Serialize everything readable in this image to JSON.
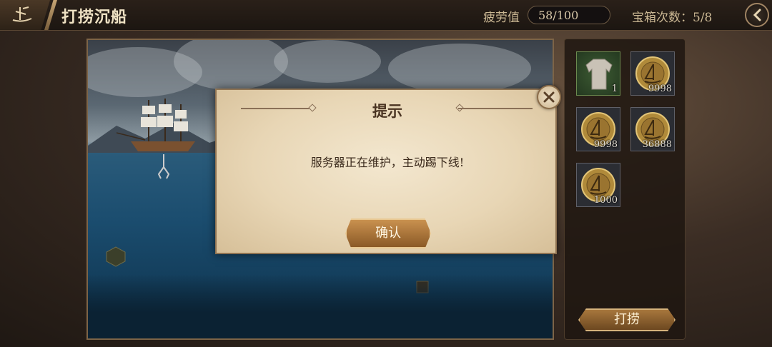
{
  "header": {
    "title": "打捞沉船",
    "fatigue_label": "疲劳值",
    "fatigue_value": "58/100",
    "chest_label": "宝箱次数：5/8"
  },
  "inventory": {
    "items": [
      {
        "icon": "shirt-icon",
        "count": "1"
      },
      {
        "icon": "coin-icon",
        "count": "9998"
      },
      {
        "icon": "coin-icon",
        "count": "9998"
      },
      {
        "icon": "coin-icon",
        "count": "36888"
      },
      {
        "icon": "coin-icon",
        "count": "1000"
      }
    ],
    "dredge_label": "打捞"
  },
  "dialog": {
    "title": "提示",
    "message": "服务器正在维护，主动踢下线!",
    "confirm_label": "确认"
  },
  "colors": {
    "parchment": "#e8d6b5",
    "button_gold": "#a7773d",
    "sea_blue": "#1b4d6f"
  }
}
